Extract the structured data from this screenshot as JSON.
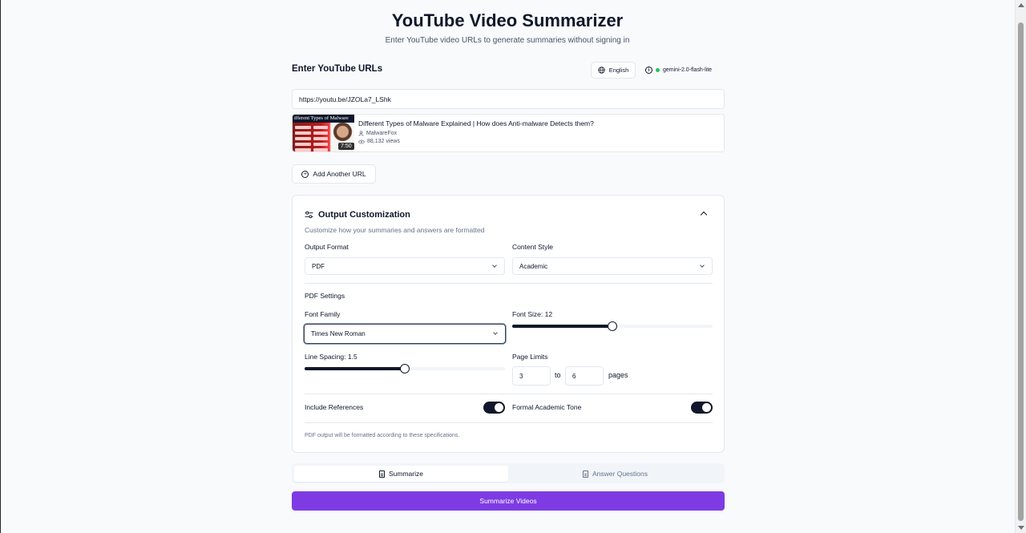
{
  "header": {
    "title": "YouTube Video Summarizer",
    "subtitle": "Enter YouTube video URLs to generate summaries without signing in"
  },
  "urls_section": {
    "label": "Enter YouTube URLs",
    "language_button": "English",
    "model_name": "gemini-2.0-flash-lite",
    "url_value": "https://youtu.be/JZOLa7_LShk",
    "add_url_label": "Add Another URL"
  },
  "video": {
    "thumbnail_title": "ifferent Types of Malware",
    "duration": "7:50",
    "title": "Different Types of Malware Explained | How does Anti-malware Detects them?",
    "channel": "MalwareFox",
    "views": "88,132 views"
  },
  "customization": {
    "title": "Output Customization",
    "description": "Customize how your summaries and answers are formatted",
    "output_format_label": "Output Format",
    "output_format_value": "PDF",
    "content_style_label": "Content Style",
    "content_style_value": "Academic",
    "pdf_settings_label": "PDF Settings",
    "font_family_label": "Font Family",
    "font_family_value": "Times New Roman",
    "font_size_label": "Font Size: 12",
    "font_size_fraction": 0.5,
    "line_spacing_label": "Line Spacing: 1.5",
    "line_spacing_fraction": 0.5,
    "page_limits_label": "Page Limits",
    "page_min": "3",
    "page_to": "to",
    "page_max": "6",
    "pages_label": "pages",
    "include_references_label": "Include References",
    "include_references_on": true,
    "formal_tone_label": "Formal Academic Tone",
    "formal_tone_on": true,
    "note": "PDF output will be formatted according to these specifications."
  },
  "tabs": {
    "summarize": "Summarize",
    "answer_questions": "Answer Questions",
    "active": "summarize"
  },
  "submit_label": "Summarize Videos",
  "colors": {
    "accent": "#7e3be3",
    "status_dot": "#22c55e"
  }
}
